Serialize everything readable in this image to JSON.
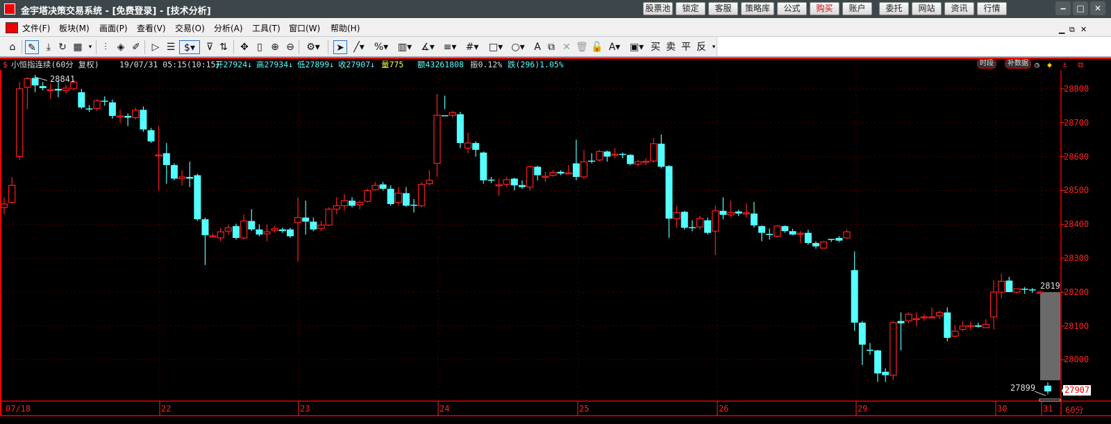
{
  "window": {
    "title": "金宇塔决策交易系统 - [免费登录] - [技术分析]",
    "buttons": [
      "股票池",
      "锁定",
      "客服",
      "策略库",
      "公式",
      "购买",
      "账户",
      "委托",
      "网站",
      "资讯",
      "行情"
    ],
    "controls": {
      "minimize": "‒",
      "maximize": "□",
      "close": "✕"
    }
  },
  "menu": {
    "items": [
      "文件(F)",
      "板块(M)",
      "画面(P)",
      "查看(V)",
      "交易(O)",
      "分析(A)",
      "工具(T)",
      "窗口(W)",
      "帮助(H)"
    ],
    "mdi": {
      "minimize": "▁",
      "restore": "⧉",
      "close": "✕"
    }
  },
  "toolbar": {
    "trade_labels": [
      "买",
      "卖",
      "平",
      "反"
    ]
  },
  "info": {
    "symbol": "小恒指连续(60分 复权)",
    "datetime": "19/07/31 05:15(10:15)",
    "open": "开27924↓",
    "high": "高27934↓",
    "low": "低27899↓",
    "close": "收27907↓",
    "volume": "量775",
    "amount": "额43261808",
    "amplitude": "振0.12%",
    "change": "跌(296)1.05%",
    "btn_period": "时段",
    "btn_fill": "补数据"
  },
  "colors": {
    "up": "#ff2020",
    "down": "#54ffff",
    "grid": "#8b0000",
    "axis": "#ff2222"
  },
  "chart_data": {
    "type": "candlestick",
    "period": "60分",
    "y_ticks": [
      28800,
      28700,
      28600,
      28500,
      28400,
      28300,
      28200,
      28100,
      28000
    ],
    "y_tick_labels": [
      "28800",
      "28700",
      "28600",
      "28500",
      "28400",
      "28300",
      "28200",
      "28100",
      "28000"
    ],
    "ylim": [
      27860,
      28860
    ],
    "date_labels": [
      "07/18",
      "22",
      "23",
      "24",
      "25",
      "26",
      "29",
      "30",
      "31"
    ],
    "period_label": "60分",
    "annotations": {
      "max": "28841",
      "right_level": "2819",
      "min": "27899",
      "last_price": "27907"
    },
    "ohlc": [
      [
        28450,
        28480,
        28430,
        28460
      ],
      [
        28465,
        28540,
        28460,
        28515
      ],
      [
        28600,
        28820,
        28590,
        28800
      ],
      [
        28805,
        28835,
        28740,
        28830
      ],
      [
        28832,
        28841,
        28790,
        28810
      ],
      [
        28808,
        28820,
        28795,
        28802
      ],
      [
        28796,
        28815,
        28770,
        28798
      ],
      [
        28800,
        28825,
        28775,
        28795
      ],
      [
        28795,
        28812,
        28785,
        28802
      ],
      [
        28800,
        28825,
        28795,
        28820
      ],
      [
        28790,
        28800,
        28740,
        28745
      ],
      [
        28742,
        28752,
        28732,
        28740
      ],
      [
        28742,
        28770,
        28735,
        28765
      ],
      [
        28765,
        28778,
        28750,
        28762
      ],
      [
        28760,
        28768,
        28712,
        28720
      ],
      [
        28718,
        28738,
        28700,
        28720
      ],
      [
        28720,
        28728,
        28690,
        28715
      ],
      [
        28715,
        28745,
        28710,
        28737
      ],
      [
        28738,
        28748,
        28673,
        28680
      ],
      [
        28678,
        28685,
        28640,
        28645
      ],
      [
        28602,
        28690,
        28500,
        28605
      ],
      [
        28610,
        28640,
        28520,
        28575
      ],
      [
        28575,
        28580,
        28530,
        28535
      ],
      [
        28535,
        28560,
        28515,
        28540
      ],
      [
        28540,
        28585,
        28510,
        28535
      ],
      [
        28545,
        28550,
        28410,
        28415
      ],
      [
        28415,
        28420,
        28280,
        28368
      ],
      [
        28366,
        28375,
        28360,
        28366
      ],
      [
        28360,
        28390,
        28350,
        28378
      ],
      [
        28380,
        28400,
        28370,
        28390
      ],
      [
        28395,
        28402,
        28355,
        28360
      ],
      [
        28360,
        28430,
        28355,
        28410
      ],
      [
        28410,
        28445,
        28380,
        28385
      ],
      [
        28385,
        28400,
        28365,
        28370
      ],
      [
        28372,
        28400,
        28350,
        28378
      ],
      [
        28382,
        28396,
        28375,
        28387
      ],
      [
        28385,
        28390,
        28375,
        28380
      ],
      [
        28385,
        28390,
        28360,
        28365
      ],
      [
        28405,
        28480,
        28290,
        28420
      ],
      [
        28420,
        28470,
        28370,
        28408
      ],
      [
        28408,
        28420,
        28380,
        28385
      ],
      [
        28388,
        28410,
        28380,
        28398
      ],
      [
        28398,
        28450,
        28395,
        28445
      ],
      [
        28445,
        28480,
        28430,
        28455
      ],
      [
        28455,
        28490,
        28440,
        28470
      ],
      [
        28470,
        28480,
        28450,
        28455
      ],
      [
        28458,
        28470,
        28445,
        28465
      ],
      [
        28468,
        28505,
        28465,
        28500
      ],
      [
        28502,
        28525,
        28500,
        28515
      ],
      [
        28518,
        28525,
        28500,
        28505
      ],
      [
        28505,
        28515,
        28455,
        28460
      ],
      [
        28465,
        28510,
        28455,
        28492
      ],
      [
        28492,
        28510,
        28452,
        28455
      ],
      [
        28458,
        28475,
        28435,
        28455
      ],
      [
        28455,
        28525,
        28450,
        28518
      ],
      [
        28520,
        28560,
        28515,
        28530
      ],
      [
        28580,
        28785,
        28540,
        28722
      ],
      [
        28722,
        28780,
        28740,
        28720
      ],
      [
        28722,
        28735,
        28715,
        28730
      ],
      [
        28725,
        28732,
        28625,
        28640
      ],
      [
        28625,
        28670,
        28610,
        28640
      ],
      [
        28640,
        28645,
        28600,
        28620
      ],
      [
        28612,
        28615,
        28520,
        28530
      ],
      [
        28532,
        28540,
        28522,
        28530
      ],
      [
        28515,
        28535,
        28485,
        28517
      ],
      [
        28518,
        28540,
        28510,
        28532
      ],
      [
        28535,
        28538,
        28500,
        28515
      ],
      [
        28516,
        28530,
        28505,
        28510
      ],
      [
        28510,
        28573,
        28500,
        28570
      ],
      [
        28570,
        28573,
        28530,
        28545
      ],
      [
        28540,
        28555,
        28525,
        28542
      ],
      [
        28545,
        28560,
        28540,
        28553
      ],
      [
        28555,
        28560,
        28545,
        28550
      ],
      [
        28550,
        28575,
        28550,
        28552
      ],
      [
        28580,
        28650,
        28530,
        28540
      ],
      [
        28540,
        28620,
        28535,
        28585
      ],
      [
        28588,
        28610,
        28580,
        28585
      ],
      [
        28590,
        28620,
        28585,
        28615
      ],
      [
        28615,
        28618,
        28585,
        28600
      ],
      [
        28605,
        28625,
        28595,
        28607
      ],
      [
        28608,
        28612,
        28595,
        28605
      ],
      [
        28605,
        28607,
        28575,
        28578
      ],
      [
        28578,
        28590,
        28570,
        28585
      ],
      [
        28585,
        28595,
        28575,
        28586
      ],
      [
        28587,
        28655,
        28582,
        28638
      ],
      [
        28638,
        28665,
        28565,
        28570
      ],
      [
        28572,
        28575,
        28360,
        28417
      ],
      [
        28417,
        28455,
        28390,
        28435
      ],
      [
        28437,
        28440,
        28385,
        28390
      ],
      [
        28392,
        28412,
        28380,
        28390
      ],
      [
        28392,
        28425,
        28385,
        28418
      ],
      [
        28412,
        28420,
        28370,
        28375
      ],
      [
        28380,
        28455,
        28310,
        28440
      ],
      [
        28440,
        28480,
        28415,
        28428
      ],
      [
        28428,
        28470,
        28420,
        28435
      ],
      [
        28438,
        28443,
        28425,
        28432
      ],
      [
        28432,
        28462,
        28420,
        28434
      ],
      [
        28432,
        28466,
        28390,
        28397
      ],
      [
        28395,
        28397,
        28350,
        28375
      ],
      [
        28372,
        28388,
        28355,
        28370
      ],
      [
        28365,
        28398,
        28360,
        28395
      ],
      [
        28395,
        28397,
        28375,
        28380
      ],
      [
        28380,
        28387,
        28368,
        28370
      ],
      [
        28372,
        28380,
        28345,
        28374
      ],
      [
        28375,
        28384,
        28340,
        28345
      ],
      [
        28345,
        28350,
        28328,
        28335
      ],
      [
        28330,
        28350,
        28330,
        28348
      ],
      [
        28357,
        28357,
        28348,
        28355
      ],
      [
        28360,
        28365,
        28348,
        28352
      ],
      [
        28360,
        28385,
        28358,
        28378
      ],
      [
        28265,
        28320,
        28085,
        28110
      ],
      [
        28110,
        28115,
        27985,
        28045
      ],
      [
        28030,
        28050,
        28015,
        28028
      ],
      [
        28028,
        28030,
        27935,
        27960
      ],
      [
        27965,
        27975,
        27935,
        27955
      ],
      [
        27955,
        28115,
        27940,
        28110
      ],
      [
        28115,
        28140,
        28028,
        28108
      ],
      [
        28115,
        28140,
        28108,
        28135
      ],
      [
        28120,
        28140,
        28100,
        28122
      ],
      [
        28125,
        28135,
        28115,
        28127
      ],
      [
        28125,
        28155,
        28125,
        28127
      ],
      [
        28130,
        28145,
        28120,
        28140
      ],
      [
        28140,
        28155,
        28055,
        28065
      ],
      [
        28070,
        28103,
        28068,
        28085
      ],
      [
        28090,
        28115,
        28085,
        28100
      ],
      [
        28100,
        28113,
        28090,
        28101
      ],
      [
        28102,
        28110,
        28095,
        28098
      ],
      [
        28095,
        28120,
        28095,
        28105
      ],
      [
        28127,
        28235,
        28090,
        28200
      ],
      [
        28200,
        28255,
        28182,
        28232
      ],
      [
        28234,
        28245,
        28200,
        28200
      ],
      [
        28200,
        28210,
        28195,
        28210
      ],
      [
        28210,
        28215,
        28195,
        28208
      ],
      [
        28208,
        28212,
        28198,
        28205
      ],
      [
        28198,
        28205,
        28195,
        28200
      ],
      [
        27924,
        27934,
        27899,
        27907
      ]
    ]
  }
}
